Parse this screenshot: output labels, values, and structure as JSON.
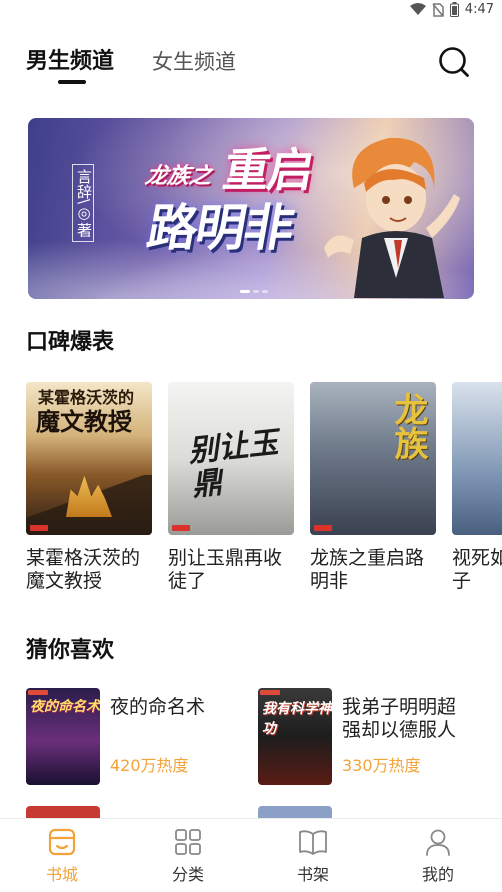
{
  "status_bar": {
    "time": "4:47"
  },
  "tabs": {
    "male": "男生频道",
    "female": "女生频道"
  },
  "banner": {
    "author": "言辞\\◎著",
    "title_part1": "龙族之",
    "title_part2": "重启",
    "title_part3": "路明非"
  },
  "section_popular": {
    "title": "口碑爆表",
    "books": [
      {
        "name": "某霍格沃茨的魔文教授",
        "cover_top": "某霍格沃茨的",
        "cover_main": "魔文教授"
      },
      {
        "name": "别让玉鼎再收徒了",
        "cover_main": "别让玉鼎"
      },
      {
        "name": "龙族之重启路明非",
        "cover_main": "龙族"
      },
      {
        "name": "视死如归魏君子"
      }
    ]
  },
  "section_guess": {
    "title": "猜你喜欢",
    "items": [
      {
        "name": "夜的命名术",
        "heat": "420万热度",
        "cover_title": "夜的命名术"
      },
      {
        "name": "我弟子明明超强却以德服人",
        "heat": "330万热度",
        "cover_title": "我有科学神功"
      }
    ]
  },
  "bottom_nav": [
    {
      "label": "书城",
      "icon": "store-icon",
      "active": true
    },
    {
      "label": "分类",
      "icon": "grid-icon",
      "active": false
    },
    {
      "label": "书架",
      "icon": "book-icon",
      "active": false
    },
    {
      "label": "我的",
      "icon": "user-icon",
      "active": false
    }
  ],
  "colors": {
    "accent": "#f2a33a",
    "text": "#1a1a1a"
  }
}
